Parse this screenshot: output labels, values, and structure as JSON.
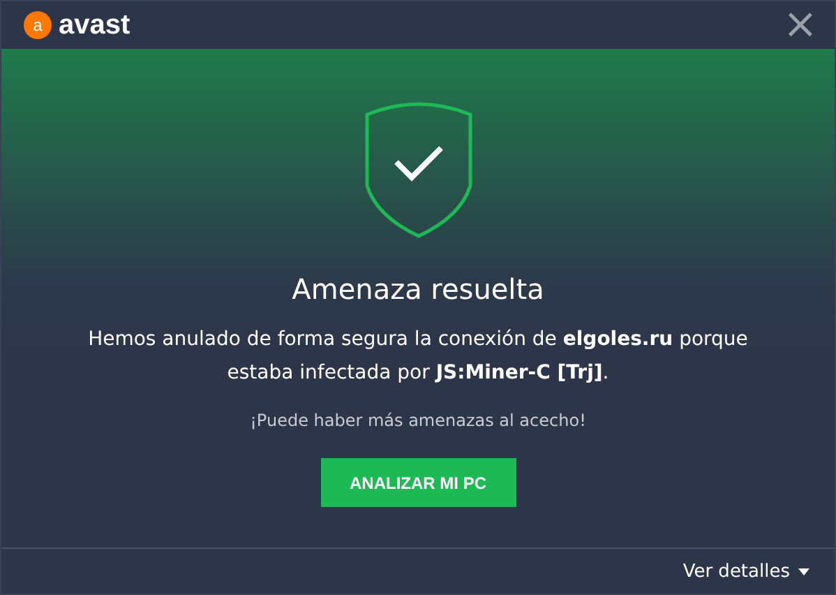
{
  "header": {
    "logo_mark": "a",
    "brand": "avast",
    "close": "×"
  },
  "title": "Amenaza resuelta",
  "message": "Hemos anulado de forma segura la conexión de **elgoles.ru** porque estaba infectada por **JS:Miner-C [Trj]**.",
  "warning": "¡Puede haber más amenazas al acecho!",
  "scan_button": "ANALIZAR MI PC",
  "footer": {
    "details_link": "Ver detalles"
  }
}
